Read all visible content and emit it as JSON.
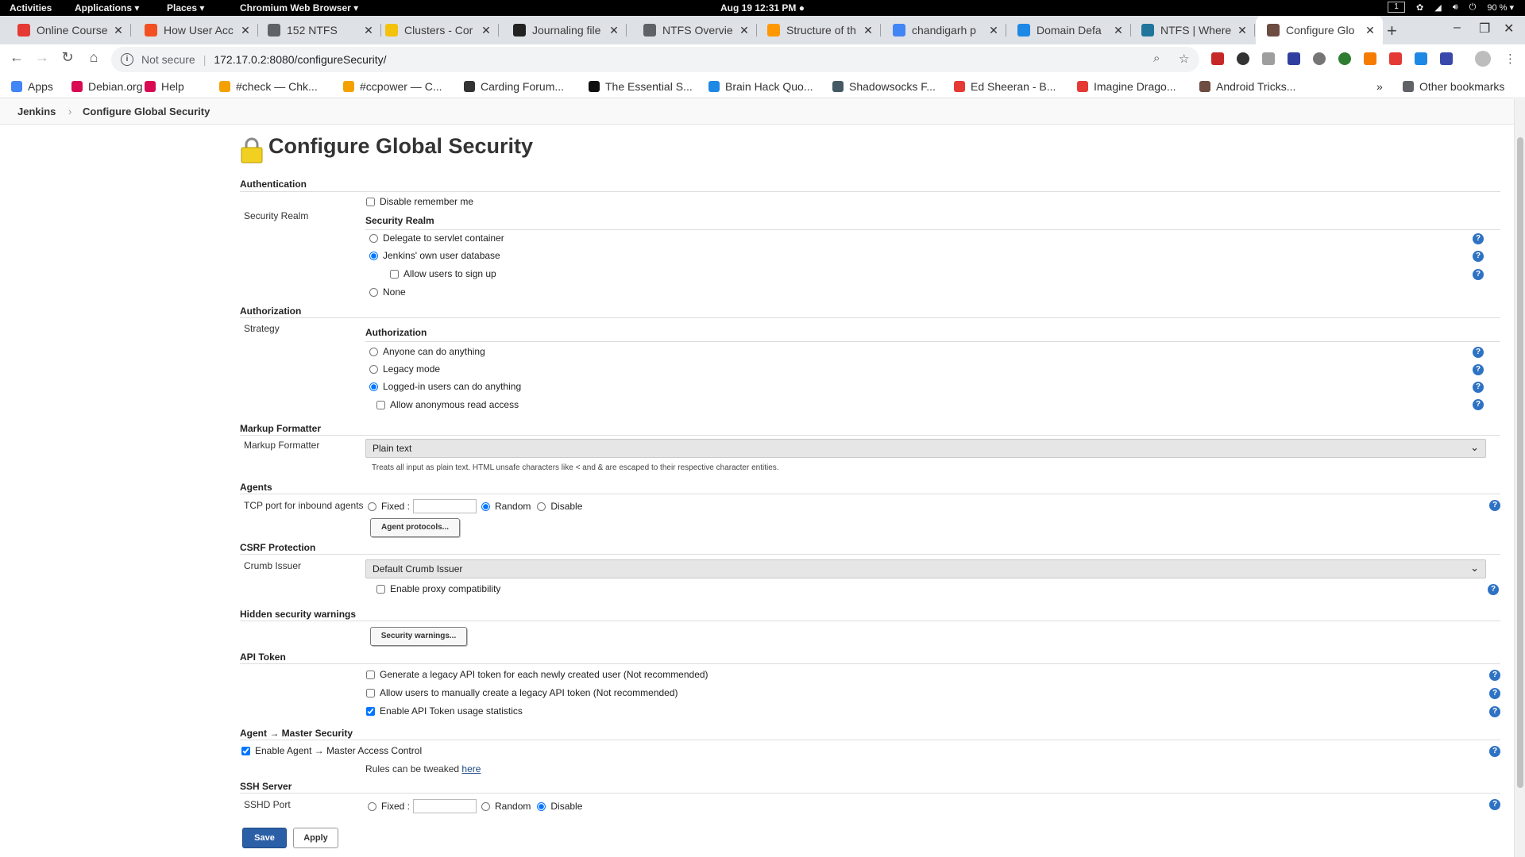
{
  "topbar": {
    "activities": "Activities",
    "applications": "Applications ▾",
    "places": "Places ▾",
    "app_name": "Chromium Web Browser ▾",
    "clock": "Aug 19  12:31 PM ●",
    "workspace": "1",
    "battery": "90 % ▾"
  },
  "tabs": [
    {
      "title": "Online Course",
      "favicon_color": "#e53935"
    },
    {
      "title": "How User Acc",
      "favicon_color": "#f25022"
    },
    {
      "title": "152 NTFS",
      "favicon_color": "#5f6368"
    },
    {
      "title": "Clusters - Cor",
      "favicon_color": "#f4c20d"
    },
    {
      "title": "Journaling file",
      "favicon_color": "#222222"
    },
    {
      "title": "NTFS Overvie",
      "favicon_color": "#5f6368"
    },
    {
      "title": "Structure of th",
      "favicon_color": "#ff9800"
    },
    {
      "title": "chandigarh p",
      "favicon_color": "#4285f4"
    },
    {
      "title": "Domain Defa",
      "favicon_color": "#1e88e5"
    },
    {
      "title": "NTFS | Where",
      "favicon_color": "#21759b"
    },
    {
      "title": "Configure Glo",
      "favicon_color": "#6d4c41",
      "active": true
    }
  ],
  "toolbar": {
    "not_secure": "Not secure",
    "url": "172.17.0.2:8080/configureSecurity/"
  },
  "bookmarks": [
    {
      "label": "Apps",
      "color": "#4285f4"
    },
    {
      "label": "Debian.org",
      "color": "#d70a53"
    },
    {
      "label": "Help",
      "color": "#d70a53"
    },
    {
      "label": "#check — Chk...",
      "color": "#f4a100"
    },
    {
      "label": "#ccpower — C...",
      "color": "#f4a100"
    },
    {
      "label": "Carding Forum...",
      "color": "#333333"
    },
    {
      "label": "The Essential S...",
      "color": "#111111"
    },
    {
      "label": "Brain Hack Quo...",
      "color": "#1e88e5"
    },
    {
      "label": "Shadowsocks F...",
      "color": "#455a64"
    },
    {
      "label": "Ed Sheeran - B...",
      "color": "#e53935"
    },
    {
      "label": "Imagine Drago...",
      "color": "#e53935"
    },
    {
      "label": "Android Tricks...",
      "color": "#6d4c41"
    }
  ],
  "other_bookmarks": "Other bookmarks",
  "breadcrumb": {
    "root": "Jenkins",
    "sep": "›",
    "current": "Configure Global Security"
  },
  "page": {
    "title": "Configure Global Security",
    "authentication": {
      "section": "Authentication",
      "disable_remember_me": "Disable remember me",
      "label": "Security Realm",
      "sub_title": "Security Realm",
      "options": [
        "Delegate to servlet container",
        "Jenkins' own user database",
        "None"
      ],
      "allow_signup": "Allow users to sign up"
    },
    "authorization": {
      "section": "Authorization",
      "label": "Strategy",
      "sub_title": "Authorization",
      "options": [
        "Anyone can do anything",
        "Legacy mode",
        "Logged-in users can do anything"
      ],
      "allow_anon": "Allow anonymous read access"
    },
    "markup": {
      "section": "Markup Formatter",
      "label": "Markup Formatter",
      "value": "Plain text",
      "note": "Treats all input as plain text. HTML unsafe characters like < and & are escaped to their respective character entities."
    },
    "agents": {
      "section": "Agents",
      "label": "TCP port for inbound agents",
      "fixed": "Fixed :",
      "random": "Random",
      "disable": "Disable",
      "protocols_button": "Agent protocols..."
    },
    "csrf": {
      "section": "CSRF Protection",
      "label": "Crumb Issuer",
      "value": "Default Crumb Issuer",
      "proxy": "Enable proxy compatibility"
    },
    "hidden_warnings": {
      "section": "Hidden security warnings",
      "button": "Security warnings..."
    },
    "api_token": {
      "section": "API Token",
      "legacy_new_user": "Generate a legacy API token for each newly created user (Not recommended)",
      "legacy_manual": "Allow users to manually create a legacy API token (Not recommended)",
      "usage_stats": "Enable API Token usage statistics"
    },
    "agent_master": {
      "section": "Agent → Master Security",
      "enable": "Enable Agent → Master Access Control",
      "rules_text": "Rules can be tweaked",
      "rules_link": "here"
    },
    "ssh": {
      "section": "SSH Server",
      "label": "SSHD Port",
      "fixed": "Fixed :",
      "random": "Random",
      "disable": "Disable"
    },
    "save": "Save",
    "apply": "Apply"
  }
}
